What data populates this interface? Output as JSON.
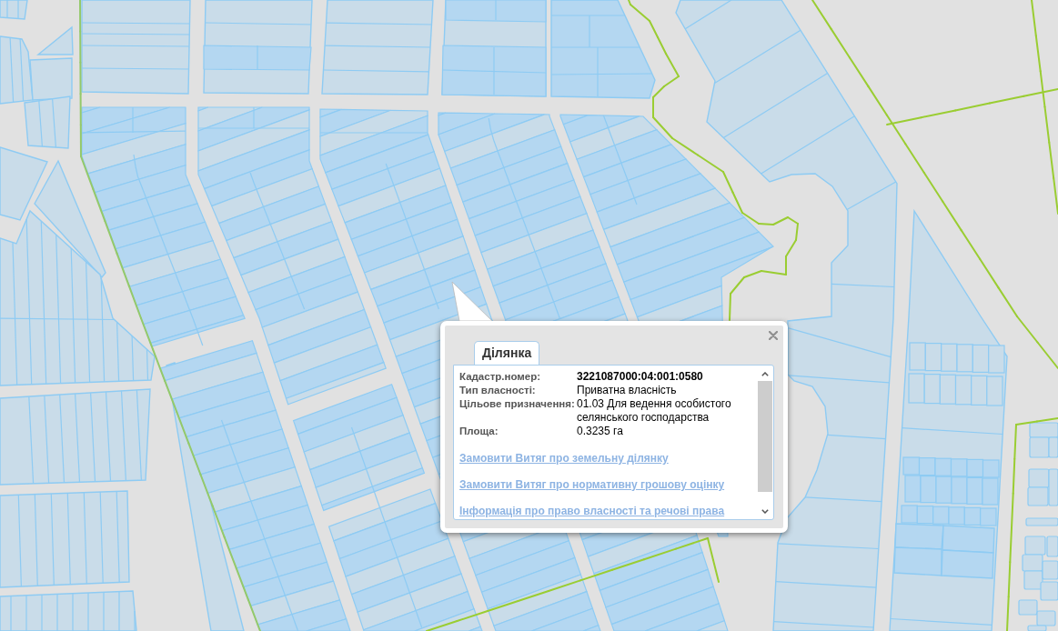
{
  "popup": {
    "tabs": [
      {
        "label": "Ділянка",
        "selected": true
      }
    ],
    "fields": [
      {
        "label": "Кадастр.номер:",
        "value": "3221087000:04:001:0580",
        "bold": true
      },
      {
        "label": "Тип власності:",
        "value": "Приватна власність",
        "bold": false
      },
      {
        "label": "Цільове призначення:",
        "value": "01.03 Для ведення особистого селянського господарства",
        "bold": false
      },
      {
        "label": "Площа:",
        "value": "0.3235 га",
        "bold": false
      }
    ],
    "links": [
      "Замовити Витяг про земельну ділянку",
      "Замовити Витяг про нормативну грошову оцінку",
      "Інформація про право власності та речові права"
    ]
  }
}
